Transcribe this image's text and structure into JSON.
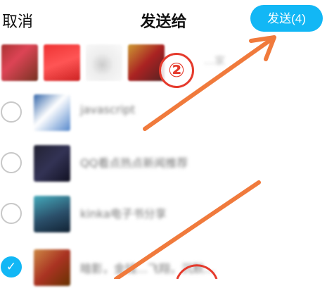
{
  "header": {
    "cancel_label": "取消",
    "title": "发送给",
    "send_label": "发送(4)"
  },
  "selected": {
    "blurred_name": "…家"
  },
  "contacts": [
    {
      "name": "javascript",
      "checked": false
    },
    {
      "name": "QQ看点热点新闻推荐",
      "checked": false
    },
    {
      "name": "kinka电子书分享",
      "checked": false
    },
    {
      "name": "暗影，金钱…飞翔，沉默…",
      "checked": true
    }
  ],
  "annotations": {
    "marker_2": "②"
  },
  "colors": {
    "accent": "#12b7f5",
    "arrow": "#f07a3c",
    "marker": "#e53a2c"
  }
}
